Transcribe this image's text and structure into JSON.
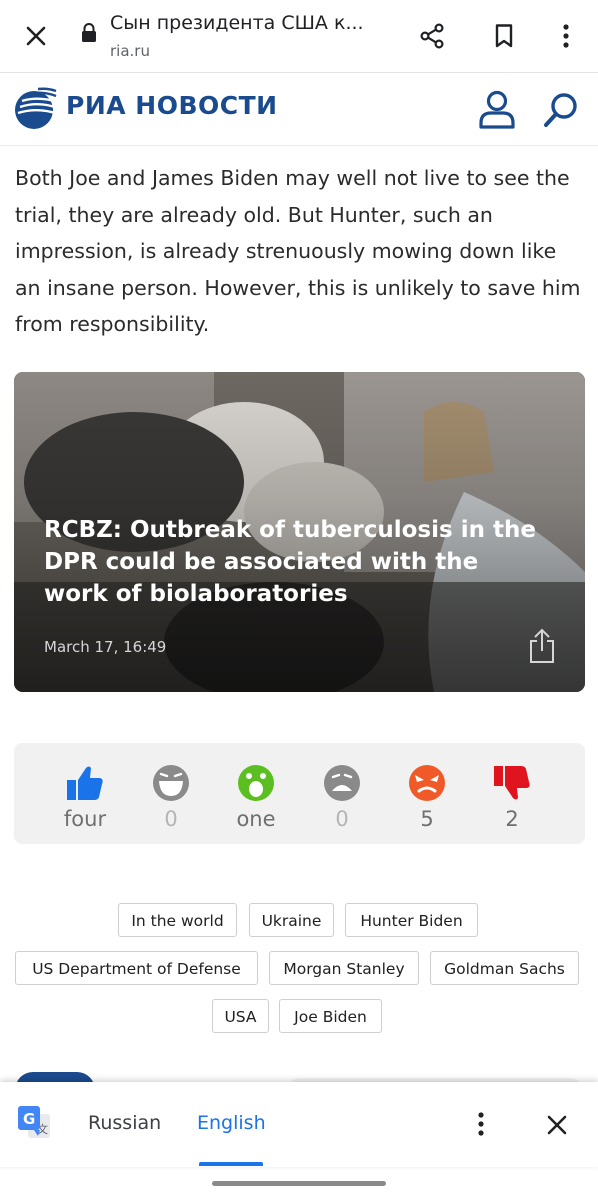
{
  "browser": {
    "title": "Сын президента США к...",
    "url": "ria.ru"
  },
  "site": {
    "logo_text": "РИА НОВОСТИ",
    "brand_color": "#1a4b8e"
  },
  "article": {
    "paragraph": "Both Joe and James Biden may well not live to see the trial, they are already old. But Hunter, such an impression, is already strenuously mowing down like an insane person. However, this is unlikely to save him from responsibility."
  },
  "related_card": {
    "title": "RCBZ: Outbreak of tuberculosis in the DPR could be associated with the work of biolaboratories",
    "date": "March 17, 16:49"
  },
  "reactions": [
    {
      "icon": "thumbs-up-icon",
      "count": "four",
      "color": "#1a73e8"
    },
    {
      "icon": "laughing-face-icon",
      "count": "0",
      "color": "#8a8a8a"
    },
    {
      "icon": "surprised-face-icon",
      "count": "one",
      "color": "#5bbf21"
    },
    {
      "icon": "sad-face-icon",
      "count": "0",
      "color": "#8a8a8a"
    },
    {
      "icon": "angry-face-icon",
      "count": "5",
      "color": "#f05a28"
    },
    {
      "icon": "thumbs-down-icon",
      "count": "2",
      "color": "#e0141e"
    }
  ],
  "tags": [
    "In the world",
    "Ukraine",
    "Hunter Biden",
    "US Department of Defense",
    "Morgan Stanley",
    "Goldman Sachs",
    "USA",
    "Joe Biden"
  ],
  "translate_bar": {
    "source_language": "Russian",
    "target_language": "English",
    "accent_color": "#1a73e8"
  }
}
